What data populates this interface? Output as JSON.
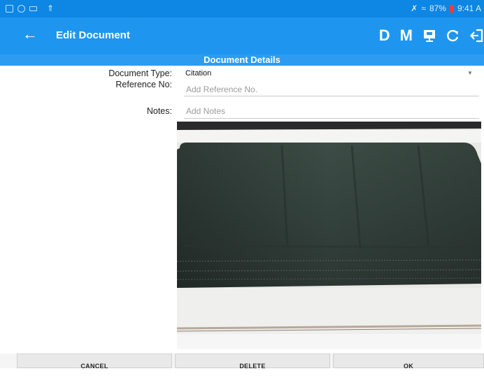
{
  "status_bar": {
    "battery": "87%",
    "time": "9:41 A"
  },
  "toolbar": {
    "title": "Edit Document",
    "actions": [
      {
        "label": "D"
      },
      {
        "label": "M"
      }
    ],
    "icons": [
      "back-arrow-icon",
      "presentation-icon",
      "refresh-icon",
      "exit-icon"
    ]
  },
  "section": {
    "title": "Document Details"
  },
  "form": {
    "document_type_label": "Document Type:",
    "document_type_value": "Citation",
    "reference_label": "Reference No:",
    "reference_placeholder": "Add Reference No.",
    "notes_label": "Notes:",
    "notes_placeholder": "Add Notes"
  },
  "buttons": {
    "cancel": "CANCEL",
    "delete": "DELETE",
    "ok": "OK"
  },
  "colors": {
    "status_bar": "#0d86e4",
    "toolbar": "#1e96ef",
    "section_header": "#2d9cf0"
  }
}
